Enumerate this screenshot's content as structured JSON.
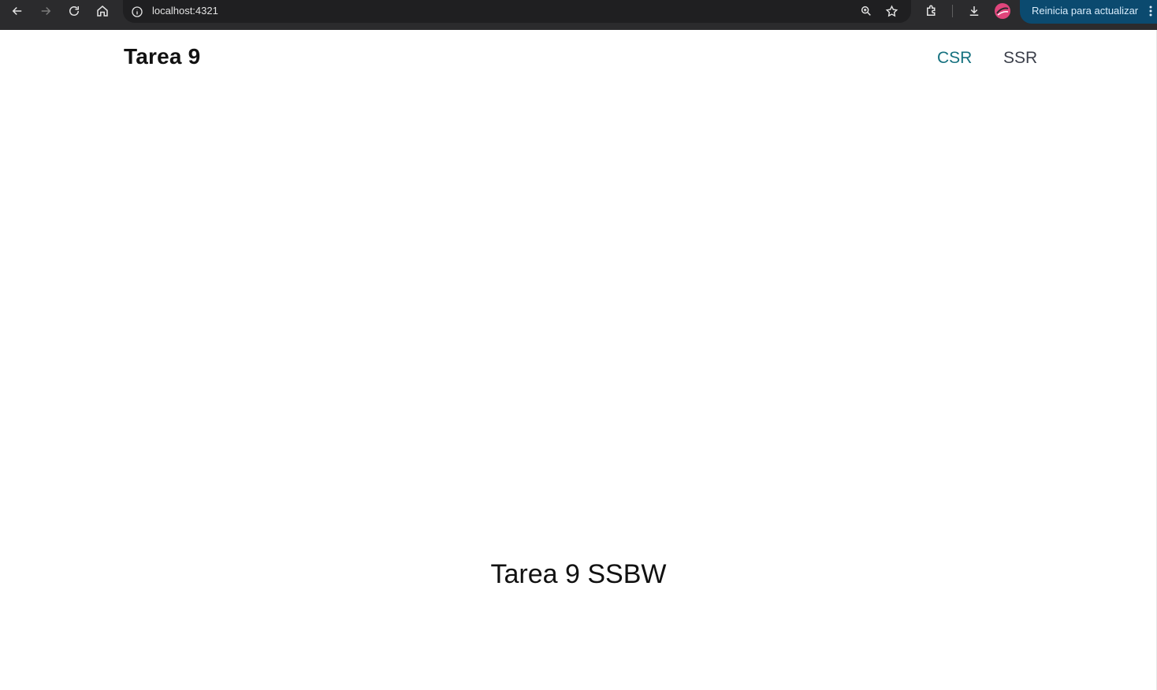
{
  "browser": {
    "url": "localhost:4321",
    "update_label": "Reinicia para actualizar",
    "icons": {
      "back": "arrow-left-icon",
      "forward": "arrow-right-icon",
      "reload": "reload-icon",
      "home": "home-icon",
      "site_info": "info-icon",
      "zoom": "zoom-icon",
      "bookmark": "star-icon",
      "extensions": "puzzle-icon",
      "downloads": "download-icon",
      "profile": "avatar",
      "menu": "kebab-menu-icon"
    },
    "colors": {
      "toolbar": "#2b2b2d",
      "omnibox": "#1f1f21",
      "update_pill": "#0b4a6f"
    }
  },
  "header": {
    "title": "Tarea 9",
    "nav": [
      {
        "label": "CSR",
        "active": true
      },
      {
        "label": "SSR",
        "active": false
      }
    ]
  },
  "main": {
    "heading": "Tarea 9 SSBW"
  },
  "colors": {
    "active_link": "#15717f",
    "link": "#3b3f4a",
    "text": "#111111",
    "background": "#ffffff"
  }
}
